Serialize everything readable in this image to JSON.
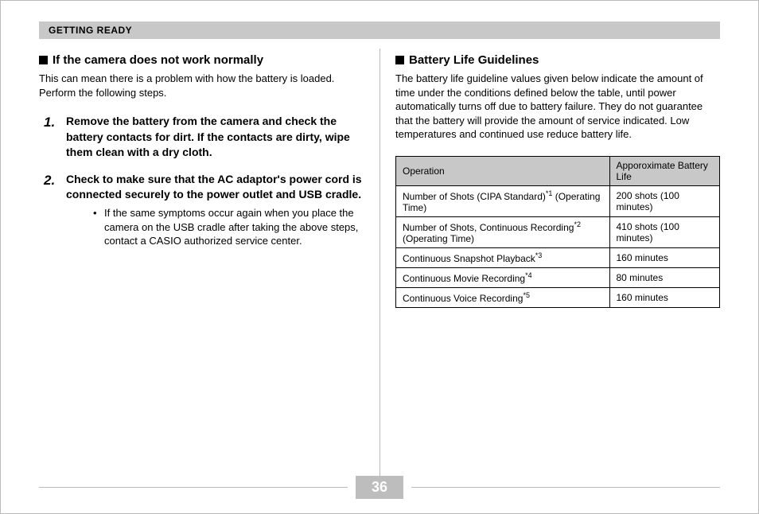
{
  "section_title": "GETTING READY",
  "page_number": "36",
  "left": {
    "heading": "If the camera does not work normally",
    "intro": "This can mean there is a problem with how the battery is loaded. Perform the following steps.",
    "steps": [
      {
        "text": "Remove the battery from the camera and check the battery contacts for dirt. If the contacts are dirty, wipe them clean with a dry cloth."
      },
      {
        "text": "Check to make sure that the AC adaptor's power cord is connected securely to the power outlet and USB cradle.",
        "sub": "If the same symptoms occur again when you place the camera on the USB cradle after taking the above steps, contact a CASIO authorized service center."
      }
    ]
  },
  "right": {
    "heading": "Battery Life Guidelines",
    "intro": "The battery life guideline values given below indicate the amount of time under the conditions defined below the table, until power automatically turns off due to battery failure. They do not guarantee that the battery will provide the amount of service indicated. Low temperatures and continued use reduce battery life.",
    "table": {
      "head_op": "Operation",
      "head_life": "Apporoximate Battery Life",
      "rows": [
        {
          "op_pre": "Number of Shots (CIPA Standard)",
          "op_sup": "*1",
          "op_post": " (Operating Time)",
          "life": "200 shots (100 minutes)"
        },
        {
          "op_pre": "Number of Shots, Continuous Recording",
          "op_sup": "*2",
          "op_post": " (Operating Time)",
          "life": "410 shots (100 minutes)"
        },
        {
          "op_pre": "Continuous Snapshot Playback",
          "op_sup": "*3",
          "op_post": "",
          "life": "160 minutes"
        },
        {
          "op_pre": "Continuous Movie Recording",
          "op_sup": "*4",
          "op_post": "",
          "life": "80 minutes"
        },
        {
          "op_pre": "Continuous Voice Recording",
          "op_sup": "*5",
          "op_post": "",
          "life": "160 minutes"
        }
      ]
    }
  }
}
